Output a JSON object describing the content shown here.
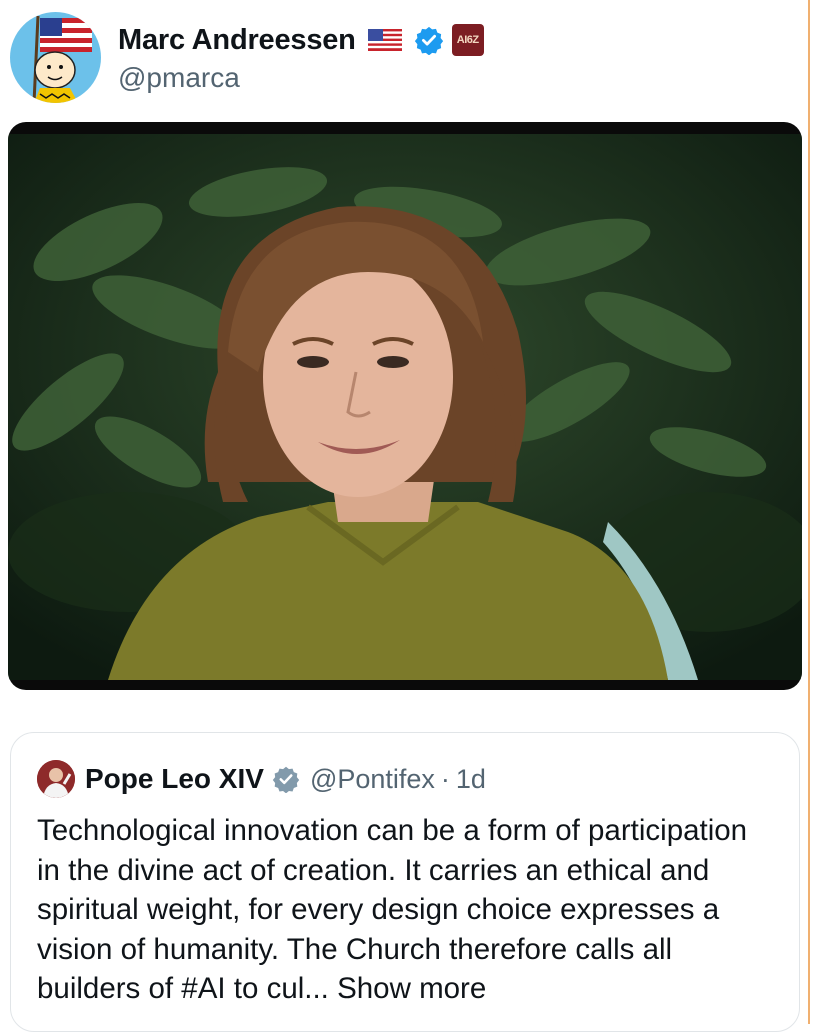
{
  "author": {
    "display_name": "Marc Andreessen",
    "handle": "@pmarca",
    "flag_icon": "us-flag-icon",
    "verified_icon": "verified-badge-icon",
    "affiliation_badge": "AI6Z",
    "affiliation_color": "#7c1d22"
  },
  "media": {
    "type": "video-still",
    "icon": "video-frame"
  },
  "quote": {
    "display_name": "Pope Leo XIV",
    "handle": "@Pontifex",
    "separator": "·",
    "time": "1d",
    "text": "Technological innovation can be a form of participation in the divine act of creation. It carries an ethical and spiritual weight, for every design choice expresses a vision of humanity. The Church therefore calls all builders of #AI to cul...",
    "show_more": "Show more",
    "verified_color": "#829aab"
  },
  "colors": {
    "verified_blue": "#1d9bf0",
    "secondary_text": "#536471",
    "primary_text": "#0f1419"
  }
}
